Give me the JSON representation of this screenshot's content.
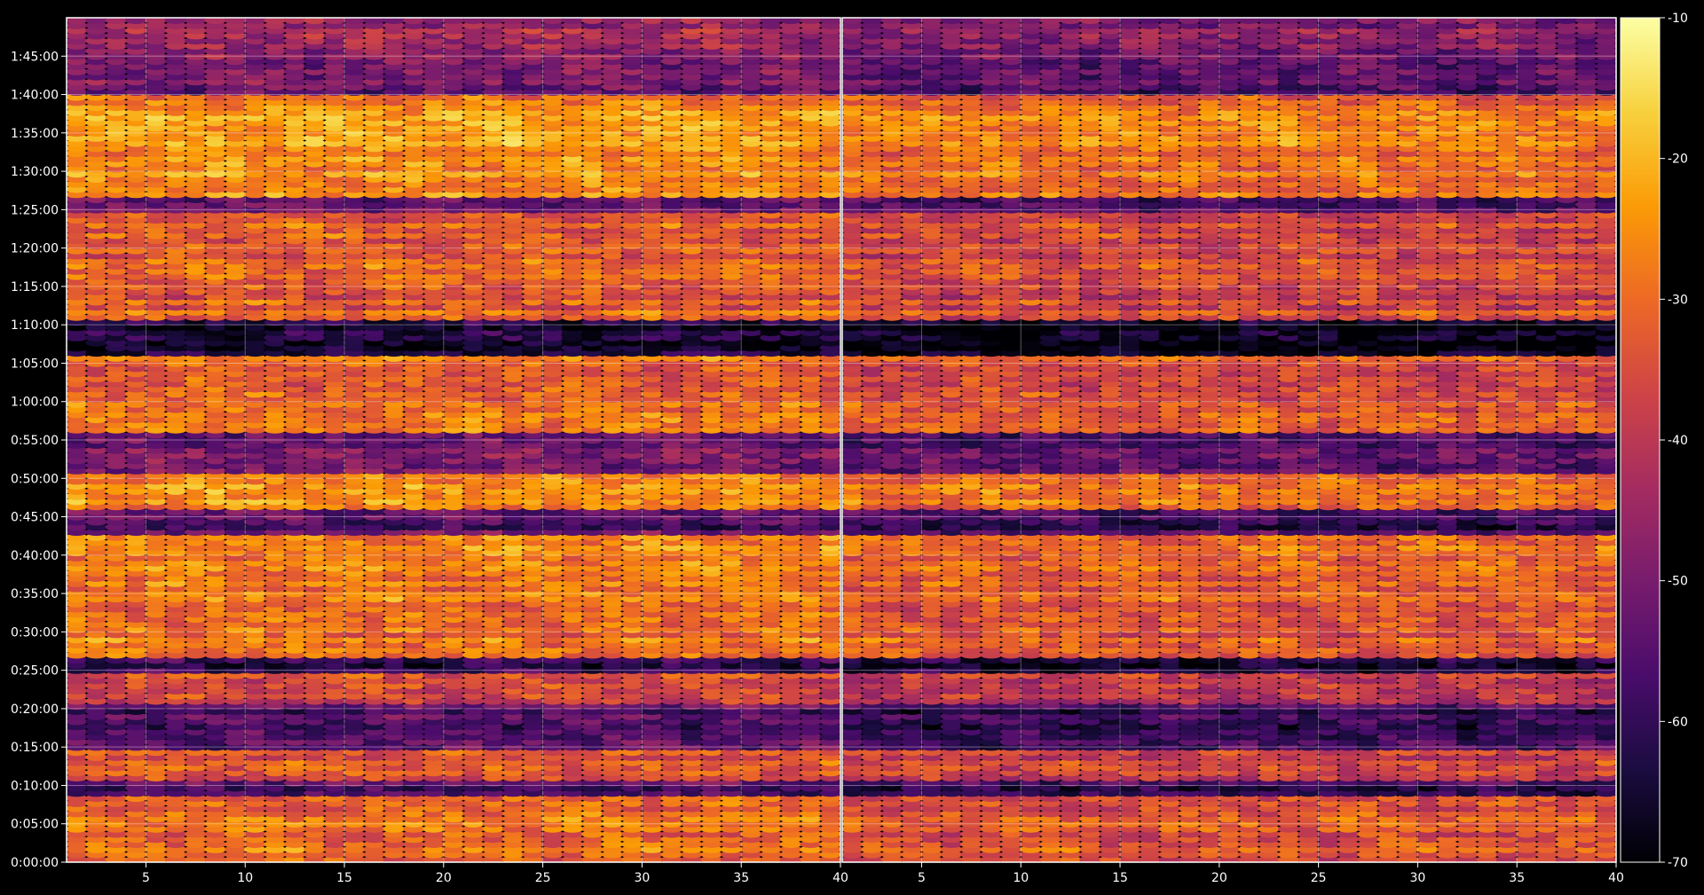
{
  "chart_data": {
    "type": "heatmap",
    "colormap": "inferno",
    "colors": {
      "background": "#000000",
      "axes_frame": "#ffffff",
      "grid": "#ffffff",
      "tick_text": "#ffffff",
      "colormap_stops": [
        "#000004",
        "#1b0c41",
        "#4a0c6b",
        "#781c6d",
        "#a52c60",
        "#cf4446",
        "#ed6925",
        "#fb9b06",
        "#f7d13d",
        "#fcffa4"
      ]
    },
    "grid": true,
    "panels": [
      {
        "name": "",
        "xlim": [
          1,
          40
        ],
        "ylim_seconds": [
          0,
          6600
        ],
        "x_tick_labels": [
          "5",
          "10",
          "15",
          "20",
          "25",
          "30",
          "35",
          "40"
        ],
        "y_tick_labels": [
          "0:00:00",
          "0:05:00",
          "0:10:00",
          "0:15:00",
          "0:20:00",
          "0:25:00",
          "0:30:00",
          "0:35:00",
          "0:40:00",
          "0:45:00",
          "0:50:00",
          "0:55:00",
          "1:00:00",
          "1:05:00",
          "1:10:00",
          "1:15:00",
          "1:20:00",
          "1:25:00",
          "1:30:00",
          "1:35:00",
          "1:40:00",
          "1:45:00"
        ],
        "grid": true
      },
      {
        "name": "",
        "xlim": [
          1,
          40
        ],
        "ylim_seconds": [
          0,
          6600
        ],
        "x_tick_labels": [
          "5",
          "10",
          "15",
          "20",
          "25",
          "30",
          "35",
          "40"
        ],
        "y_tick_labels": [],
        "grid": true
      }
    ],
    "colorbar": {
      "range": [
        -70,
        -10
      ],
      "tick_labels": [
        "-10",
        "-20",
        "-30",
        "-40",
        "-50",
        "-60",
        "-70"
      ],
      "location": "right"
    },
    "intensity_profile": {
      "description_levels_dB_by_time_segment": [
        {
          "from": "0:00:00",
          "to": "0:09:00",
          "level": -30
        },
        {
          "from": "0:09:00",
          "to": "0:10:30",
          "level": -55
        },
        {
          "from": "0:10:30",
          "to": "0:15:00",
          "level": -34
        },
        {
          "from": "0:15:00",
          "to": "0:21:00",
          "level": -55
        },
        {
          "from": "0:21:00",
          "to": "0:25:00",
          "level": -36
        },
        {
          "from": "0:25:00",
          "to": "0:27:00",
          "level": -60
        },
        {
          "from": "0:27:00",
          "to": "0:43:00",
          "level": -28
        },
        {
          "from": "0:43:00",
          "to": "0:46:00",
          "level": -55
        },
        {
          "from": "0:46:00",
          "to": "0:51:00",
          "level": -27
        },
        {
          "from": "0:51:00",
          "to": "0:56:00",
          "level": -50
        },
        {
          "from": "0:56:00",
          "to": "1:06:00",
          "level": -30
        },
        {
          "from": "1:06:00",
          "to": "1:11:00",
          "level": -65
        },
        {
          "from": "1:11:00",
          "to": "1:25:00",
          "level": -32
        },
        {
          "from": "1:25:00",
          "to": "1:26:30",
          "level": -52
        },
        {
          "from": "1:26:30",
          "to": "1:40:00",
          "level": -25
        },
        {
          "from": "1:40:00",
          "to": "1:46:00",
          "level": -50
        },
        {
          "from": "1:46:00",
          "to": "1:50:00",
          "level": -45
        }
      ],
      "panel_offsets_dB": [
        0,
        -4
      ]
    }
  }
}
